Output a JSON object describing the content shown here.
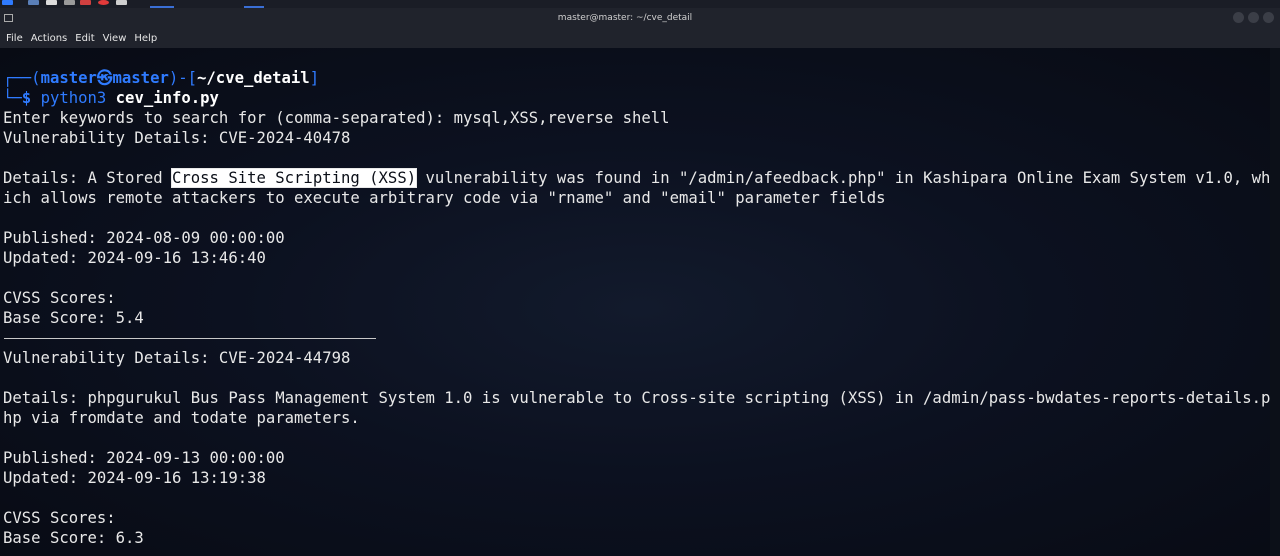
{
  "window": {
    "title": "master@master: ~/cve_detail"
  },
  "menu": [
    "File",
    "Actions",
    "Edit",
    "View",
    "Help"
  ],
  "prompt": {
    "top_left": "┌──(",
    "user": "master",
    "at_icon": "㉿",
    "host": "master",
    "mid": ")-[",
    "path": "~/cve_detail",
    "close": "]",
    "bottom_left": "└─",
    "dollar": "$ ",
    "command": "python3",
    "argument": " cev_info.py"
  },
  "output": {
    "line_keywords": "Enter keywords to search for (comma-separated): mysql,XSS,reverse shell",
    "vuln1_header": "Vulnerability Details: CVE-2024-40478",
    "vuln1_details_prefix": "Details: A Stored ",
    "vuln1_details_highlight": "Cross Site Scripting (XSS)",
    "vuln1_details_suffix": " vulnerability was found in \"/admin/afeedback.php\" in Kashipara Online Exam System v1.0, wh",
    "vuln1_details_line2": "ich allows remote attackers to execute arbitrary code via \"rname\" and \"email\" parameter fields",
    "vuln1_published": "Published: 2024-08-09 00:00:00",
    "vuln1_updated": "Updated: 2024-09-16 13:46:40",
    "vuln1_cvss": "CVSS Scores:",
    "vuln1_base": "Base Score: 5.4",
    "vuln2_header": "Vulnerability Details: CVE-2024-44798",
    "vuln2_details_line1": "Details: phpgurukul Bus Pass Management System 1.0 is vulnerable to Cross-site scripting (XSS) in /admin/pass-bwdates-reports-details.p",
    "vuln2_details_line2": "hp via fromdate and todate parameters.",
    "vuln2_published": "Published: 2024-09-13 00:00:00",
    "vuln2_updated": "Updated: 2024-09-16 13:19:38",
    "vuln2_cvss": "CVSS Scores:",
    "vuln2_base": "Base Score: 6.3"
  },
  "colors": {
    "prompt_accent": "#2f7bff",
    "background": "#0b0f18",
    "text": "#e8e8e8"
  }
}
